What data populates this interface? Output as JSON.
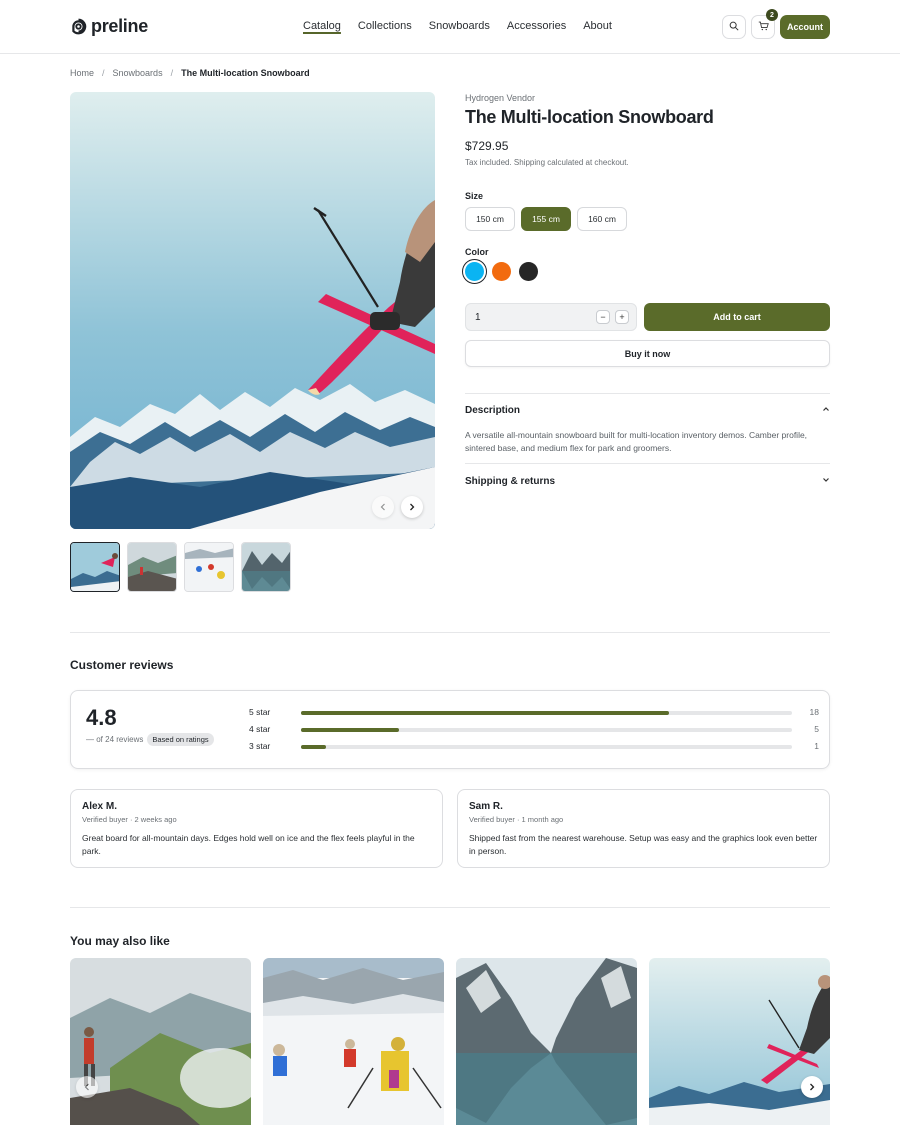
{
  "header": {
    "logo_text": "preline",
    "nav": [
      "Catalog",
      "Collections",
      "Snowboards",
      "Accessories",
      "About"
    ],
    "active_nav": "Catalog",
    "cart_count": "2",
    "account_label": "Account"
  },
  "breadcrumb": {
    "items": [
      "Home",
      "Snowboards"
    ],
    "separator": "/",
    "current": "The Multi-location Snowboard"
  },
  "product": {
    "vendor": "Hydrogen Vendor",
    "title": "The Multi-location Snowboard",
    "price": "$729.95",
    "tax_note": "Tax included. Shipping calculated at checkout.",
    "size_label": "Size",
    "sizes": [
      "150 cm",
      "155 cm",
      "160 cm"
    ],
    "selected_size": "155 cm",
    "color_label": "Color",
    "colors": [
      "#0ab4f2",
      "#f26b0f",
      "#262626"
    ],
    "selected_color": "#0ab4f2",
    "quantity": "1",
    "minus": "−",
    "plus": "+",
    "add_to_cart": "Add to cart",
    "buy_now": "Buy it now",
    "accordion": {
      "description_title": "Description",
      "description_body": "A versatile all-mountain snowboard built for multi-location inventory demos. Camber profile, sintered base, and medium flex for park and groomers.",
      "shipping_title": "Shipping & returns"
    }
  },
  "reviews": {
    "title": "Customer reviews",
    "average": "4.8",
    "count_text": "— of 24 reviews",
    "badge": "Based on ratings",
    "breakdown": [
      {
        "label": "5 star",
        "count": "18",
        "fraction": 0.75
      },
      {
        "label": "4 star",
        "count": "5",
        "fraction": 0.2
      },
      {
        "label": "3 star",
        "count": "1",
        "fraction": 0.05
      }
    ],
    "items": [
      {
        "name": "Alex M.",
        "meta": "Verified buyer · 2 weeks ago",
        "text": "Great board for all-mountain days. Edges hold well on ice and the flex feels playful in the park."
      },
      {
        "name": "Sam R.",
        "meta": "Verified buyer · 1 month ago",
        "text": "Shipped fast from the nearest warehouse. Setup was easy and the graphics look even better in person."
      }
    ]
  },
  "recommendations": {
    "title": "You may also like"
  },
  "colors": {
    "accent": "#5a6b2a",
    "border": "#dcdde0",
    "muted_text": "#6b7075"
  }
}
